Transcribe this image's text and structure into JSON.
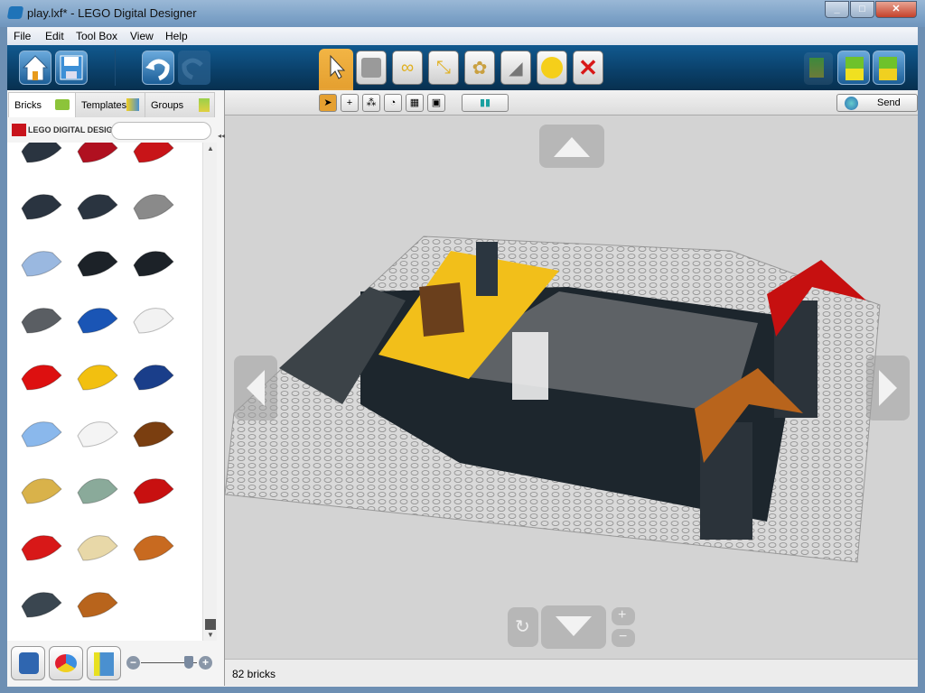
{
  "window": {
    "title": "play.lxf* - LEGO Digital Designer",
    "controls": [
      "minimize",
      "maximize",
      "close"
    ]
  },
  "menu": [
    "File",
    "Edit",
    "Tool Box",
    "View",
    "Help"
  ],
  "toolbar": {
    "left": [
      {
        "icon": "home-icon"
      },
      {
        "icon": "save-icon"
      },
      {
        "icon": "undo-icon"
      },
      {
        "icon": "redo-icon",
        "disabled": true
      }
    ],
    "tools": [
      {
        "icon": "select-cursor-icon",
        "active": true
      },
      {
        "icon": "clone-brick-icon"
      },
      {
        "icon": "hinge-icon"
      },
      {
        "icon": "hinge-align-icon"
      },
      {
        "icon": "flex-icon"
      },
      {
        "icon": "paint-bucket-icon"
      },
      {
        "icon": "decoration-icon"
      },
      {
        "icon": "delete-icon"
      }
    ],
    "modes": [
      {
        "icon": "build-mode-icon"
      },
      {
        "icon": "view-mode-icon"
      },
      {
        "icon": "building-guide-icon"
      }
    ]
  },
  "subtools": {
    "items": [
      "single-select",
      "add-select",
      "select-connected",
      "select-same-color",
      "select-same-brick",
      "select-same-color-and-brick"
    ],
    "send_label": "Send"
  },
  "left_panel": {
    "tabs": [
      {
        "label": "Bricks",
        "active": true
      },
      {
        "label": "Templates"
      },
      {
        "label": "Groups"
      }
    ],
    "logo": "LEGO DIGITAL DESIGNER",
    "search_value": "",
    "palette_colors": [
      "#2a3440",
      "#b01020",
      "#c81418",
      "#2a3440",
      "#2a3440",
      "#8a8a8a",
      "#9ab8e0",
      "#1c2228",
      "#1c2228",
      "#5a5e63",
      "#1a55b5",
      "#f2f2f2",
      "#dd1010",
      "#f2c010",
      "#1a3e8a",
      "#8ab8ec",
      "#f4f4f4",
      "#7a3e10",
      "#d9b24a",
      "#8aaa9a",
      "#c81010",
      "#d81818",
      "#e8d8a8",
      "#c86a20",
      "#3a4650",
      "#b8641c"
    ],
    "zoom_slider_value": 0.85
  },
  "status": {
    "bricks": "82 bricks"
  },
  "colors": {
    "accent": "#f0a020",
    "toolbar": "#0a3f68"
  }
}
